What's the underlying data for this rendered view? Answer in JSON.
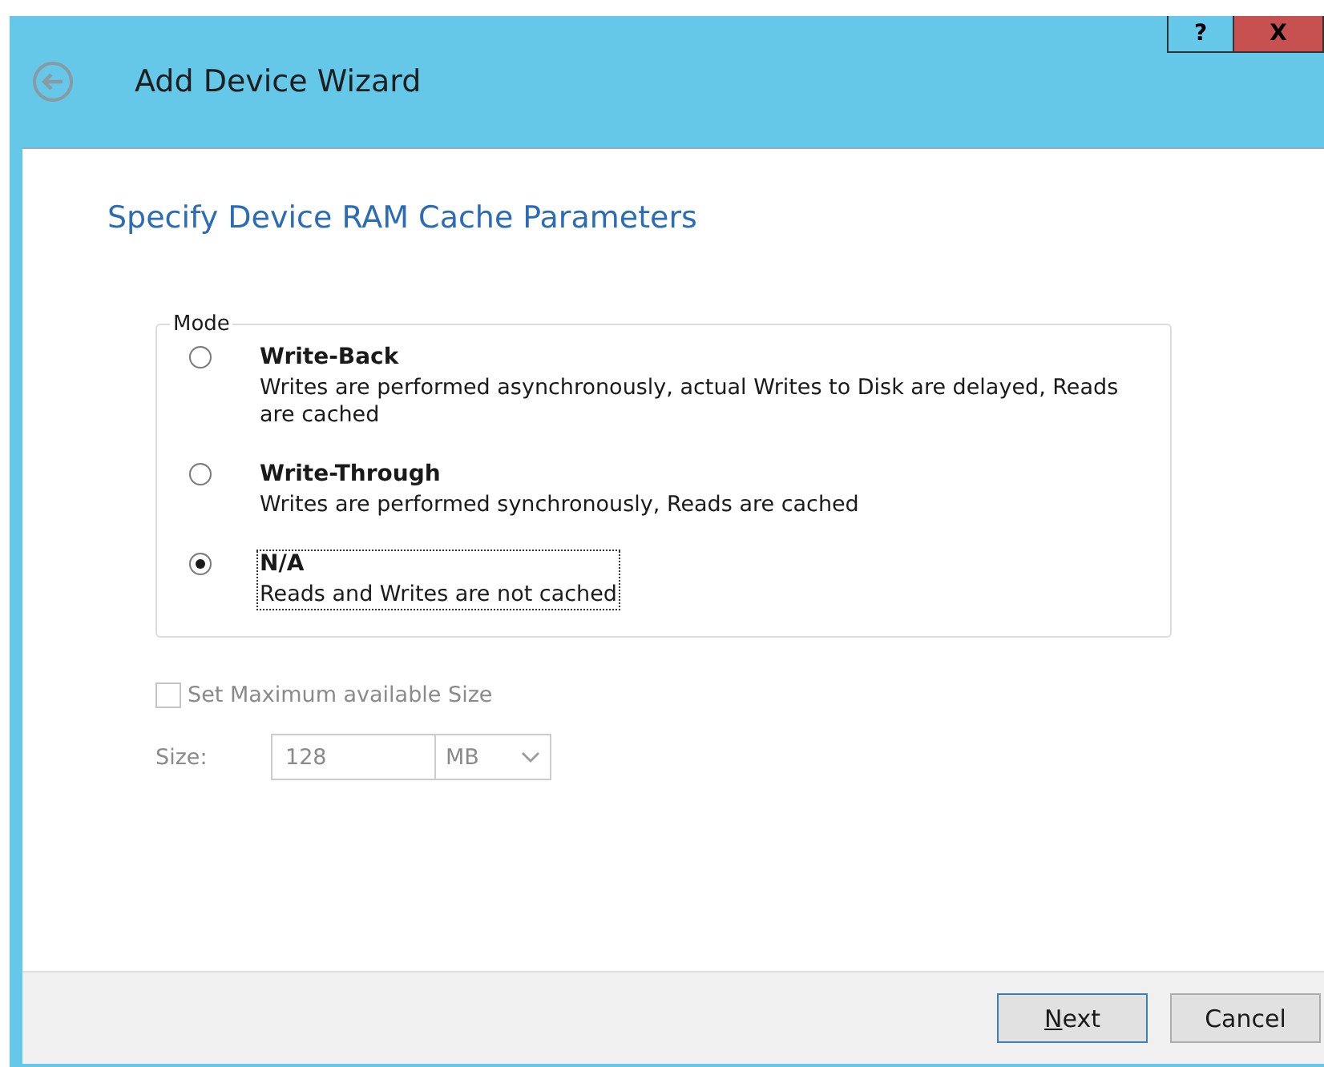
{
  "window": {
    "title": "Add Device Wizard",
    "help_button": "?",
    "close_button": "X"
  },
  "page_heading": "Specify Device RAM Cache Parameters",
  "mode_group": {
    "label": "Mode",
    "options": [
      {
        "title": "Write-Back",
        "description": "Writes are performed asynchronously, actual Writes to Disk are delayed, Reads are cached",
        "selected": false
      },
      {
        "title": "Write-Through",
        "description": "Writes are performed synchronously, Reads are cached",
        "selected": false
      },
      {
        "title": "N/A",
        "description": "Reads and Writes are not cached",
        "selected": true
      }
    ]
  },
  "max_size_checkbox": {
    "label": "Set Maximum available Size",
    "checked": false,
    "disabled": true
  },
  "size": {
    "label": "Size:",
    "value": "128",
    "unit": "MB",
    "disabled": true
  },
  "buttons": [
    {
      "label": "Next",
      "default": true,
      "underline_first": true
    },
    {
      "label": "Cancel",
      "default": false,
      "underline_first": false
    }
  ]
}
